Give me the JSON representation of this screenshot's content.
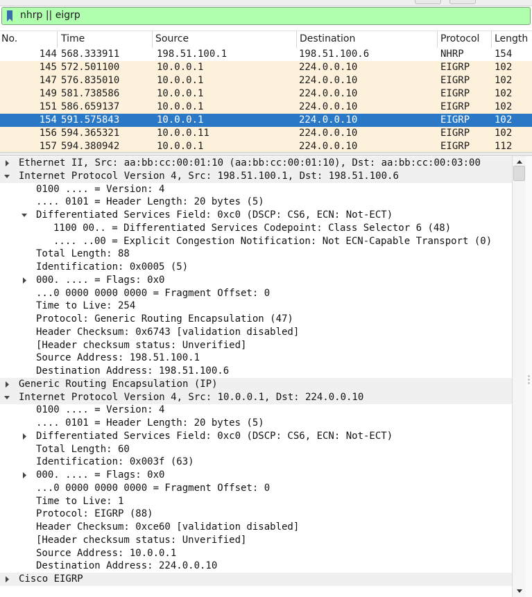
{
  "filter": {
    "text": "nhrp || eigrp"
  },
  "columns": [
    "No.",
    "Time",
    "Source",
    "Destination",
    "Protocol",
    "Length"
  ],
  "packets": [
    {
      "no": "144",
      "time": "568.333911",
      "source": "198.51.100.1",
      "destination": "198.51.100.6",
      "protocol": "NHRP",
      "length": "154",
      "style": "nhrp"
    },
    {
      "no": "145",
      "time": "572.501100",
      "source": "10.0.0.1",
      "destination": "224.0.0.10",
      "protocol": "EIGRP",
      "length": "102",
      "style": "eigrp"
    },
    {
      "no": "147",
      "time": "576.835010",
      "source": "10.0.0.1",
      "destination": "224.0.0.10",
      "protocol": "EIGRP",
      "length": "102",
      "style": "eigrp"
    },
    {
      "no": "149",
      "time": "581.738586",
      "source": "10.0.0.1",
      "destination": "224.0.0.10",
      "protocol": "EIGRP",
      "length": "102",
      "style": "eigrp"
    },
    {
      "no": "151",
      "time": "586.659137",
      "source": "10.0.0.1",
      "destination": "224.0.0.10",
      "protocol": "EIGRP",
      "length": "102",
      "style": "eigrp"
    },
    {
      "no": "154",
      "time": "591.575843",
      "source": "10.0.0.1",
      "destination": "224.0.0.10",
      "protocol": "EIGRP",
      "length": "102",
      "style": "selected"
    },
    {
      "no": "156",
      "time": "594.365321",
      "source": "10.0.0.11",
      "destination": "224.0.0.10",
      "protocol": "EIGRP",
      "length": "102",
      "style": "eigrp"
    },
    {
      "no": "157",
      "time": "594.380942",
      "source": "10.0.0.1",
      "destination": "224.0.0.10",
      "protocol": "EIGRP",
      "length": "112",
      "style": "eigrp"
    }
  ],
  "details": [
    {
      "text": "Ethernet II, Src: aa:bb:cc:00:01:10 (aa:bb:cc:00:01:10), Dst: aa:bb:cc:00:03:00",
      "level": 0,
      "arrow": "collapsed"
    },
    {
      "text": "Internet Protocol Version 4, Src: 198.51.100.1, Dst: 198.51.100.6",
      "level": 0,
      "arrow": "expanded"
    },
    {
      "text": "0100 .... = Version: 4",
      "level": 1,
      "arrow": "none"
    },
    {
      "text": ".... 0101 = Header Length: 20 bytes (5)",
      "level": 1,
      "arrow": "none"
    },
    {
      "text": "Differentiated Services Field: 0xc0 (DSCP: CS6, ECN: Not-ECT)",
      "level": 1,
      "arrow": "expanded"
    },
    {
      "text": "1100 00.. = Differentiated Services Codepoint: Class Selector 6 (48)",
      "level": 2,
      "arrow": "none"
    },
    {
      "text": ".... ..00 = Explicit Congestion Notification: Not ECN-Capable Transport (0)",
      "level": 2,
      "arrow": "none"
    },
    {
      "text": "Total Length: 88",
      "level": 1,
      "arrow": "none"
    },
    {
      "text": "Identification: 0x0005 (5)",
      "level": 1,
      "arrow": "none"
    },
    {
      "text": "000. .... = Flags: 0x0",
      "level": 1,
      "arrow": "collapsed"
    },
    {
      "text": "...0 0000 0000 0000 = Fragment Offset: 0",
      "level": 1,
      "arrow": "none"
    },
    {
      "text": "Time to Live: 254",
      "level": 1,
      "arrow": "none"
    },
    {
      "text": "Protocol: Generic Routing Encapsulation (47)",
      "level": 1,
      "arrow": "none"
    },
    {
      "text": "Header Checksum: 0x6743 [validation disabled]",
      "level": 1,
      "arrow": "none"
    },
    {
      "text": "[Header checksum status: Unverified]",
      "level": 1,
      "arrow": "none"
    },
    {
      "text": "Source Address: 198.51.100.1",
      "level": 1,
      "arrow": "none"
    },
    {
      "text": "Destination Address: 198.51.100.6",
      "level": 1,
      "arrow": "none"
    },
    {
      "text": "Generic Routing Encapsulation (IP)",
      "level": 0,
      "arrow": "collapsed"
    },
    {
      "text": "Internet Protocol Version 4, Src: 10.0.0.1, Dst: 224.0.0.10",
      "level": 0,
      "arrow": "expanded"
    },
    {
      "text": "0100 .... = Version: 4",
      "level": 1,
      "arrow": "none"
    },
    {
      "text": ".... 0101 = Header Length: 20 bytes (5)",
      "level": 1,
      "arrow": "none"
    },
    {
      "text": "Differentiated Services Field: 0xc0 (DSCP: CS6, ECN: Not-ECT)",
      "level": 1,
      "arrow": "collapsed"
    },
    {
      "text": "Total Length: 60",
      "level": 1,
      "arrow": "none"
    },
    {
      "text": "Identification: 0x003f (63)",
      "level": 1,
      "arrow": "none"
    },
    {
      "text": "000. .... = Flags: 0x0",
      "level": 1,
      "arrow": "collapsed"
    },
    {
      "text": "...0 0000 0000 0000 = Fragment Offset: 0",
      "level": 1,
      "arrow": "none"
    },
    {
      "text": "Time to Live: 1",
      "level": 1,
      "arrow": "none"
    },
    {
      "text": "Protocol: EIGRP (88)",
      "level": 1,
      "arrow": "none"
    },
    {
      "text": "Header Checksum: 0xce60 [validation disabled]",
      "level": 1,
      "arrow": "none"
    },
    {
      "text": "[Header checksum status: Unverified]",
      "level": 1,
      "arrow": "none"
    },
    {
      "text": "Source Address: 10.0.0.1",
      "level": 1,
      "arrow": "none"
    },
    {
      "text": "Destination Address: 224.0.0.10",
      "level": 1,
      "arrow": "none"
    },
    {
      "text": "Cisco EIGRP",
      "level": 0,
      "arrow": "collapsed"
    }
  ],
  "colors": {
    "filter_bg": "#afffaf",
    "eigrp_row": "#fdf1dc",
    "selected_row": "#2a78c6"
  },
  "icons": {
    "filter": "bookmark-icon",
    "collapsed": "expand-arrow-icon",
    "expanded": "collapse-arrow-icon"
  }
}
